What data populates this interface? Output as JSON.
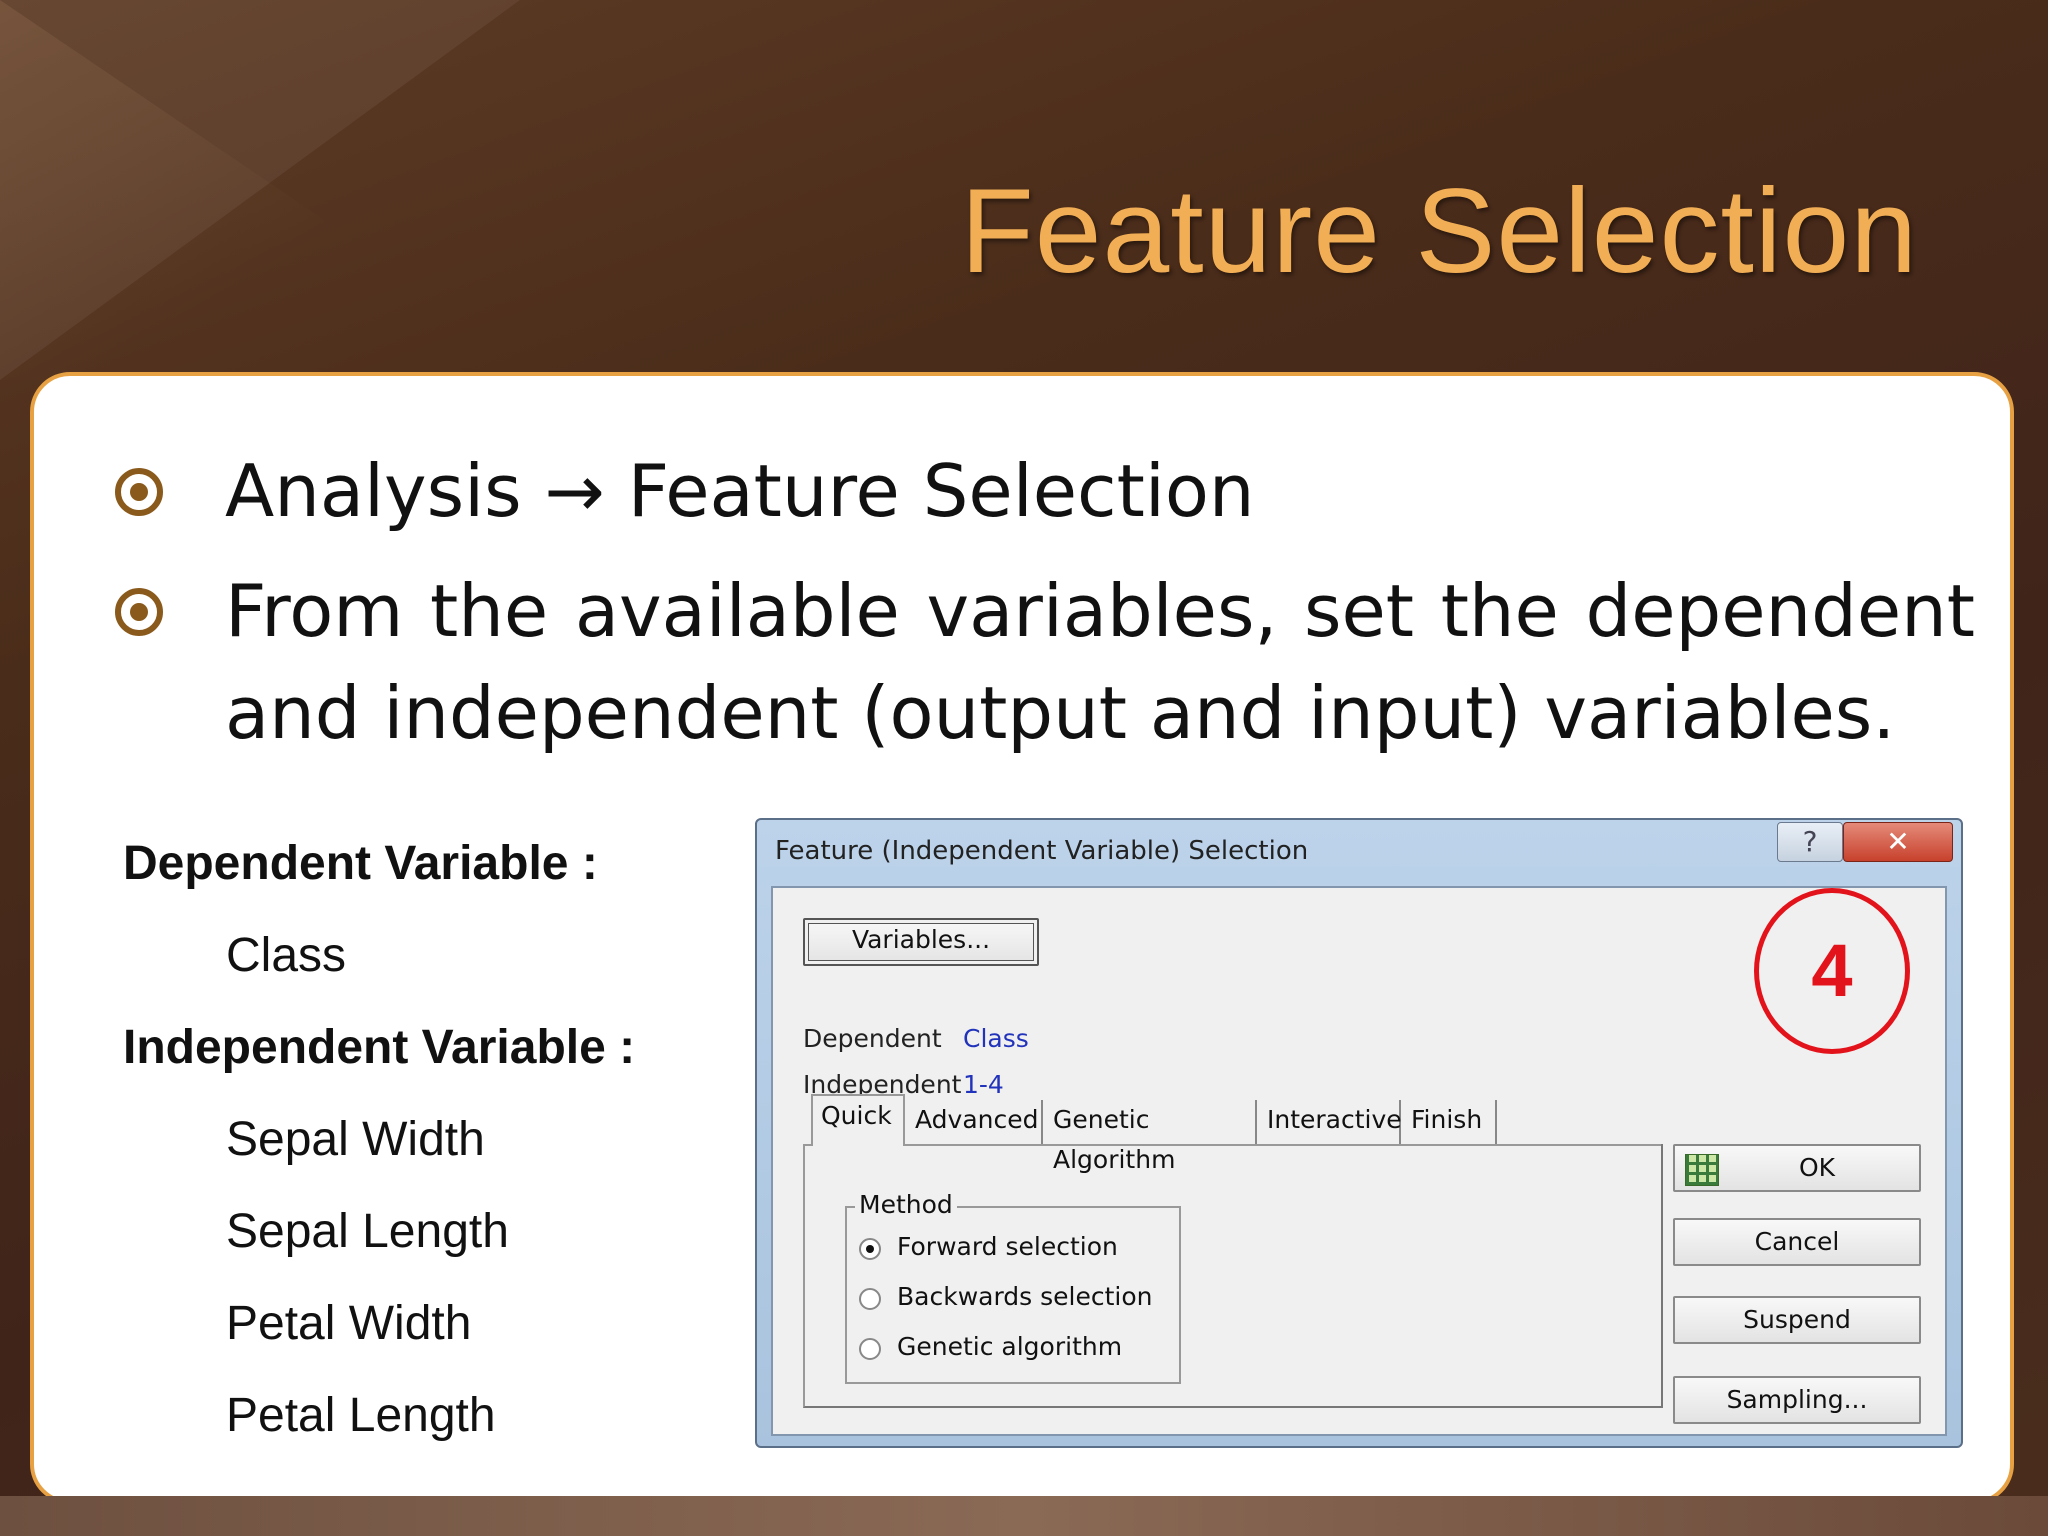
{
  "slide": {
    "title": "Feature Selection",
    "bullets": [
      "Analysis → Feature Selection",
      "From the available variables, set the dependent",
      "and independent (output and input) variables."
    ],
    "variables": {
      "dependent_label": "Dependent Variable :",
      "dependent_items": [
        "Class"
      ],
      "independent_label": "Independent Variable :",
      "independent_items": [
        "Sepal Width",
        "Sepal Length",
        "Petal Width",
        "Petal Length"
      ]
    },
    "step_badge": "4",
    "colors": {
      "title": "#f2ae55",
      "panel_border": "#e7a142",
      "badge": "#e3131b"
    }
  },
  "dialog": {
    "title": "Feature (Independent Variable) Selection",
    "help_button": "?",
    "close_button": "✕",
    "variables_button": "Variables...",
    "dependent_key": "Dependent",
    "dependent_value": "Class",
    "independent_key": "Independent",
    "independent_value": "1-4",
    "tabs": [
      "Quick",
      "Advanced",
      "Genetic Algorithm",
      "Interactive",
      "Finish"
    ],
    "active_tab": "Quick",
    "method": {
      "legend": "Method",
      "options": [
        "Forward selection",
        "Backwards selection",
        "Genetic algorithm"
      ],
      "selected": "Forward selection"
    },
    "buttons": {
      "ok": "OK",
      "cancel": "Cancel",
      "suspend": "Suspend",
      "sampling": "Sampling..."
    }
  }
}
